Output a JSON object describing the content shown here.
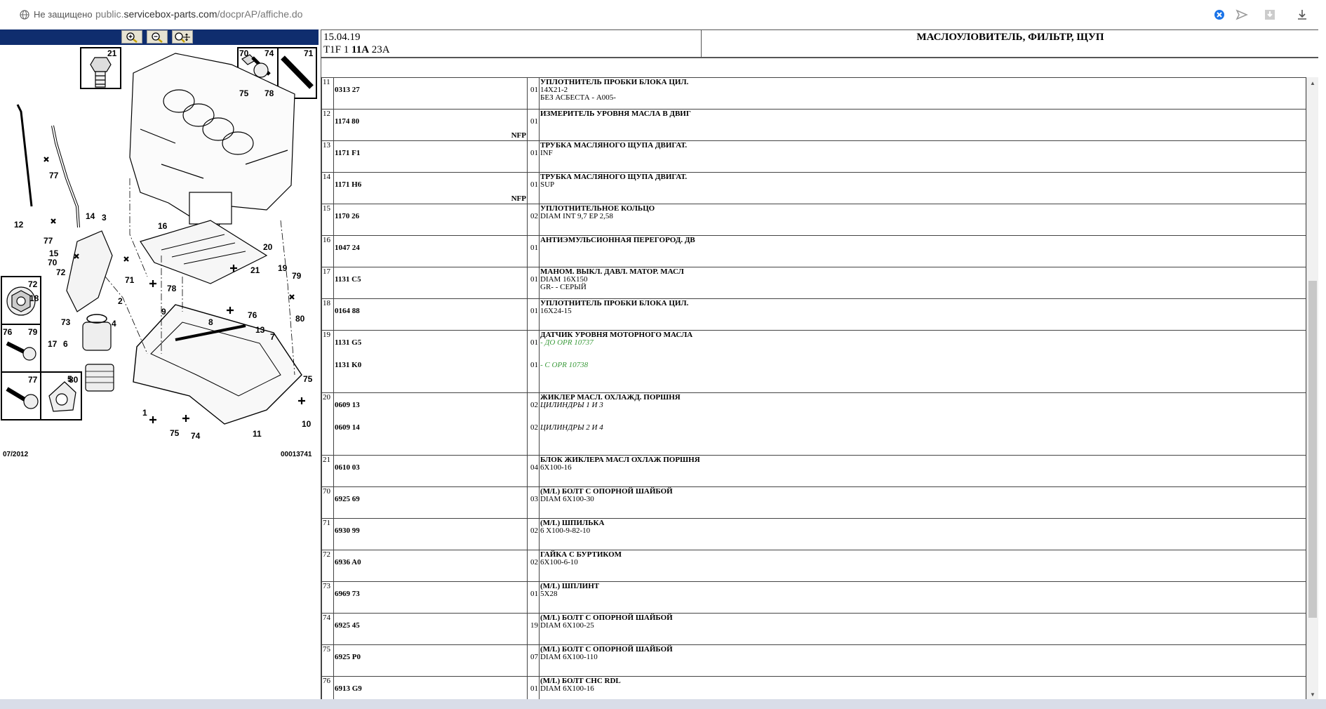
{
  "browser": {
    "security_label": "Не защищено",
    "url_prefix": "public.",
    "url_domain": "servicebox-parts.com",
    "url_path": "/docprAP/affiche.do"
  },
  "diagram": {
    "date": "07/2012",
    "ref_number": "00013741",
    "callouts": [
      "21",
      "70",
      "74",
      "71",
      "75",
      "78",
      "72",
      "76",
      "79",
      "77",
      "80",
      "12",
      "77",
      "14",
      "3",
      "15",
      "70",
      "16",
      "20",
      "21",
      "72",
      "71",
      "78",
      "19",
      "79",
      "18",
      "2",
      "76",
      "73",
      "4",
      "13",
      "17",
      "6",
      "9",
      "8",
      "80",
      "7",
      "5",
      "75",
      "1",
      "75",
      "74",
      "11",
      "10"
    ]
  },
  "header": {
    "date": "15.04.19",
    "code_prefix": "T1F 1",
    "code_bold": "11A",
    "code_suffix": "23A",
    "title": "МАСЛОУЛОВИТЕЛЬ, ФИЛЬТР, ЩУП"
  },
  "rows": [
    {
      "ref": "11",
      "part": "0313 27",
      "nfp": "",
      "qty": "01",
      "title": "УПЛОТНИТЕЛЬ ПРОБКИ БЛОКА ЦИЛ.",
      "lines": [
        "14X21-2",
        "БЕЗ АСБЕСТА - A005-"
      ]
    },
    {
      "ref": "12",
      "part": "1174 80",
      "nfp": "NFP",
      "qty": "01",
      "title": "ИЗМЕРИТЕЛЬ УРОВНЯ МАСЛА В ДВИГ",
      "lines": []
    },
    {
      "ref": "13",
      "part": "1171 F1",
      "nfp": "",
      "qty": "01",
      "title": "ТРУБКА МАСЛЯНОГО ЩУПА ДВИГАТ.",
      "lines": [
        "INF"
      ]
    },
    {
      "ref": "14",
      "part": "1171 H6",
      "nfp": "NFP",
      "qty": "01",
      "title": "ТРУБКА МАСЛЯНОГО ЩУПА ДВИГАТ.",
      "lines": [
        "SUP"
      ]
    },
    {
      "ref": "15",
      "part": "1170 26",
      "nfp": "",
      "qty": "02",
      "title": "УПЛОТНИТЕЛЬНОЕ КОЛЬЦО",
      "lines": [
        "DIAM INT 9,7 EP 2,58"
      ]
    },
    {
      "ref": "16",
      "part": "1047 24",
      "nfp": "",
      "qty": "01",
      "title": "АНТИЭМУЛЬСИОННАЯ ПЕРЕГОРОД. ДВ",
      "lines": []
    },
    {
      "ref": "17",
      "part": "1131 C5",
      "nfp": "",
      "qty": "01",
      "title": "МАНОМ. ВЫКЛ. ДАВЛ. МАТОР. МАСЛ",
      "lines": [
        "DIAM 16X150",
        "GR- - СЕРЫЙ"
      ]
    },
    {
      "ref": "18",
      "part": "0164 88",
      "nfp": "",
      "qty": "01",
      "title": "УПЛОТНИТЕЛЬ ПРОБКИ БЛОКА ЦИЛ.",
      "lines": [
        "16X24-15"
      ]
    },
    {
      "ref": "19",
      "part": "1131 G5",
      "part2": "1131 K0",
      "qty": "01",
      "qty2": "01",
      "title": "ДАТЧИК УРОВНЯ МОТОРНОГО МАСЛА",
      "green1": "- ДО OPR 10737",
      "green2": "- С OPR 10738"
    },
    {
      "ref": "20",
      "part": "0609 13",
      "part2": "0609 14",
      "qty": "02",
      "qty2": "02",
      "title": "ЖИКЛЕР МАСЛ. ОХЛАЖД. ПОРШНЯ",
      "ital1": "ЦИЛИНДРЫ 1 И 3",
      "ital2": "ЦИЛИНДРЫ 2 И 4"
    },
    {
      "ref": "21",
      "part": "0610 03",
      "nfp": "",
      "qty": "04",
      "title": "БЛОК ЖИКЛЕРА МАСЛ ОХЛАЖ ПОРШНЯ",
      "lines": [
        "6X100-16"
      ]
    },
    {
      "ref": "70",
      "part": "6925 69",
      "nfp": "",
      "qty": "03",
      "title": "(М/L) БОЛТ С ОПОРНОЙ ШАЙБОЙ",
      "lines": [
        "DIAM 6X100-30"
      ]
    },
    {
      "ref": "71",
      "part": "6930 99",
      "nfp": "",
      "qty": "02",
      "title": "(М/L) ШПИЛЬКА",
      "lines": [
        "6 X100-9-82-10"
      ]
    },
    {
      "ref": "72",
      "part": "6936 A0",
      "nfp": "",
      "qty": "02",
      "title": "ГАЙКА С БУРТИКОМ",
      "lines": [
        "6X100-6-10"
      ]
    },
    {
      "ref": "73",
      "part": "6969 73",
      "nfp": "",
      "qty": "01",
      "title": "(М/L) ШПЛИНТ",
      "lines": [
        "5X28"
      ]
    },
    {
      "ref": "74",
      "part": "6925 45",
      "nfp": "",
      "qty": "19",
      "title": "(М/L) БОЛТ С ОПОРНОЙ ШАЙБОЙ",
      "lines": [
        "DIAM 6X100-25"
      ]
    },
    {
      "ref": "75",
      "part": "6925 P0",
      "nfp": "",
      "qty": "07",
      "title": "(М/L) БОЛТ С ОПОРНОЙ ШАЙБОЙ",
      "lines": [
        "DIAM 6X100-110"
      ]
    },
    {
      "ref": "76",
      "part": "6913 G9",
      "nfp": "",
      "qty": "01",
      "title": "(М/L) БОЛТ CHC RDL",
      "lines": [
        "DIAM 6X100-16"
      ]
    }
  ],
  "colors": {
    "toolbar": "#0f2d6e",
    "green_note": "#3a9a3a"
  }
}
